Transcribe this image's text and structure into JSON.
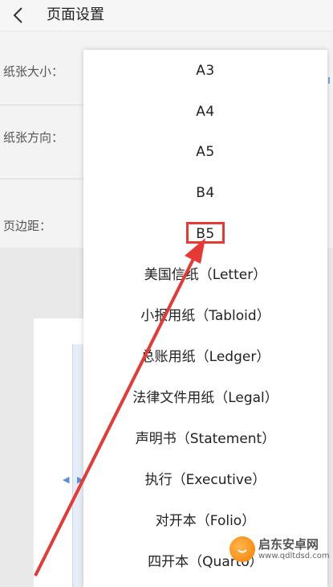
{
  "header": {
    "title": "页面设置"
  },
  "settings": {
    "paper_size_label": "纸张大小：",
    "paper_orientation_label": "纸张方向：",
    "margin_label": "页边距："
  },
  "dropdown": {
    "options": [
      "A3",
      "A4",
      "A5",
      "B4",
      "B5",
      "美国信纸（Letter）",
      "小报用纸（Tabloid）",
      "总账用纸（Ledger）",
      "法律文件用纸（Legal）",
      "声明书（Statement）",
      "执行（Executive）",
      "对开本（Folio）",
      "四开本（Quarto）"
    ],
    "highlighted": "B5"
  },
  "annotation": {
    "highlight_color": "#e53935"
  },
  "watermark": {
    "title": "启东安卓网",
    "url": "www.qdltdsd.com"
  }
}
